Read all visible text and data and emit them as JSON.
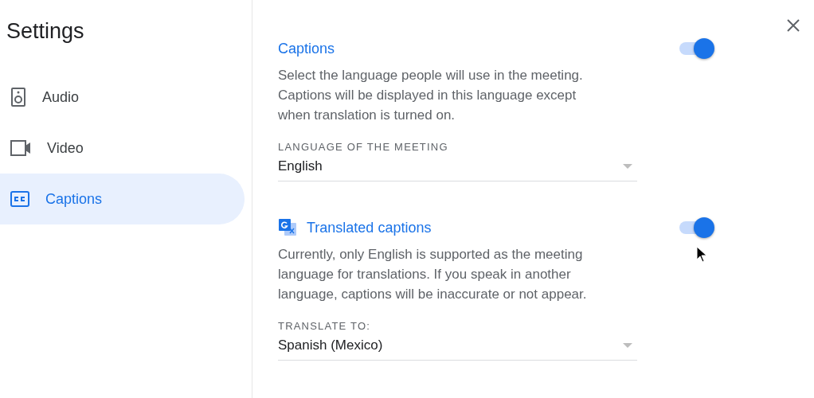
{
  "sidebar": {
    "title": "Settings",
    "items": [
      {
        "label": "Audio",
        "kind": "speaker",
        "selected": false
      },
      {
        "label": "Video",
        "kind": "camera",
        "selected": false
      },
      {
        "label": "Captions",
        "kind": "cc",
        "selected": true
      }
    ]
  },
  "sections": [
    {
      "kind": "plain",
      "title": "Captions",
      "on": true,
      "description": "Select the language people will use in the meeting. Captions will be displayed in this language except when translation is turned on.",
      "field": {
        "label": "LANGUAGE OF THE MEETING",
        "value": "English"
      }
    },
    {
      "kind": "translate",
      "title": "Translated captions",
      "on": true,
      "description": "Currently, only English is supported as the meeting language for translations. If you speak in another language, captions will be inaccurate or not appear.",
      "field": {
        "label": "TRANSLATE TO:",
        "value": "Spanish (Mexico)"
      }
    }
  ]
}
